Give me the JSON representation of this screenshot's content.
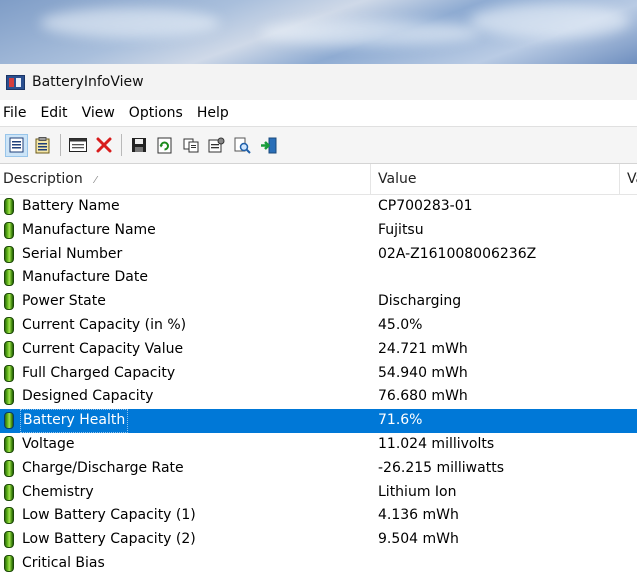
{
  "window": {
    "title": "BatteryInfoView"
  },
  "menu": [
    "File",
    "Edit",
    "View",
    "Options",
    "Help"
  ],
  "toolbar": {
    "buttons": [
      {
        "icon": "properties-list-icon",
        "pressed": true
      },
      {
        "icon": "report-list-icon",
        "pressed": false
      },
      {
        "icon": "html-report-icon",
        "pressed": false
      },
      {
        "icon": "delete-icon",
        "pressed": false
      },
      {
        "icon": "save-icon",
        "pressed": false
      },
      {
        "icon": "refresh-icon",
        "pressed": false
      },
      {
        "icon": "copy-icon",
        "pressed": false
      },
      {
        "icon": "properties-icon",
        "pressed": false
      },
      {
        "icon": "find-icon",
        "pressed": false
      },
      {
        "icon": "exit-icon",
        "pressed": false
      }
    ]
  },
  "columns": {
    "description": "Description",
    "value": "Value",
    "third": "Va"
  },
  "rows": [
    {
      "description": "Battery Name",
      "value": "CP700283-01"
    },
    {
      "description": "Manufacture Name",
      "value": "Fujitsu"
    },
    {
      "description": "Serial Number",
      "value": "02A-Z161008006236Z"
    },
    {
      "description": "Manufacture Date",
      "value": ""
    },
    {
      "description": "Power State",
      "value": "Discharging"
    },
    {
      "description": "Current Capacity (in %)",
      "value": "45.0%"
    },
    {
      "description": "Current Capacity Value",
      "value": "24.721 mWh"
    },
    {
      "description": "Full Charged Capacity",
      "value": "54.940 mWh"
    },
    {
      "description": "Designed Capacity",
      "value": "76.680 mWh"
    },
    {
      "description": "Battery Health",
      "value": "71.6%",
      "selected": true
    },
    {
      "description": "Voltage",
      "value": "11.024 millivolts"
    },
    {
      "description": "Charge/Discharge Rate",
      "value": "-26.215 milliwatts"
    },
    {
      "description": "Chemistry",
      "value": "Lithium Ion"
    },
    {
      "description": "Low Battery Capacity (1)",
      "value": "4.136 mWh"
    },
    {
      "description": "Low Battery Capacity (2)",
      "value": "9.504 mWh"
    },
    {
      "description": "Critical Bias",
      "value": ""
    }
  ],
  "colors": {
    "selection": "#0078d7",
    "battery_green": "#6abf1e"
  }
}
